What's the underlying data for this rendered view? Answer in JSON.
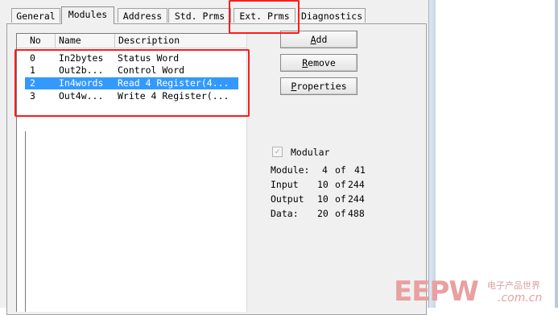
{
  "tabs": [
    "General",
    "Modules",
    "Address",
    "Std. Prms",
    "Ext. Prms",
    "Diagnostics"
  ],
  "active_tab": "Modules",
  "modules_list": {
    "columns": [
      "No",
      "Name",
      "Description"
    ],
    "rows": [
      {
        "no": "0",
        "name": "In2bytes",
        "description": "Status Word"
      },
      {
        "no": "1",
        "name": "Out2b...",
        "description": "Control Word"
      },
      {
        "no": "2",
        "name": "In4words",
        "description": "Read 4 Register(4..."
      },
      {
        "no": "3",
        "name": "Out4w...",
        "description": "Write 4 Register(..."
      }
    ],
    "selected_index": 2
  },
  "buttons": {
    "add": {
      "mnemonic": "A",
      "rest": "dd"
    },
    "remove": {
      "mnemonic": "R",
      "rest": "emove"
    },
    "properties": {
      "mnemonic": "P",
      "rest": "roperties"
    }
  },
  "modular": {
    "label": "Modular",
    "checked": true,
    "module": {
      "label": "Module:",
      "value": "4",
      "of": "of",
      "max": "41"
    },
    "input": {
      "label": "Input",
      "value": "10",
      "of": "of",
      "max": "244"
    },
    "output": {
      "label": "Output",
      "value": "10",
      "of": "of",
      "max": "244"
    },
    "data": {
      "label": "Data:",
      "value": "20",
      "of": "of",
      "max": "488"
    }
  },
  "icons": {
    "checkbox": "check-icon"
  },
  "colors": {
    "selection": "#3399ff",
    "highlight": "#ff1a1a",
    "watermark": "#e9a0a0"
  },
  "watermark": {
    "brand": "EEPW",
    "chinese": "电子产品世界",
    "domain": ".com.cn"
  }
}
